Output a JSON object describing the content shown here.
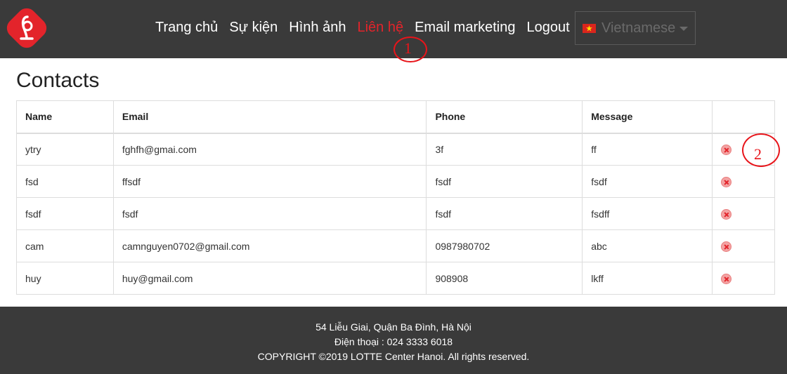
{
  "header": {
    "nav": [
      {
        "label": "Trang chủ",
        "active": false
      },
      {
        "label": "Sự kiện",
        "active": false
      },
      {
        "label": "Hình ảnh",
        "active": false
      },
      {
        "label": "Liên hệ",
        "active": true
      },
      {
        "label": "Email marketing",
        "active": false
      },
      {
        "label": "Logout",
        "active": false
      }
    ],
    "language": {
      "selected": "Vietnamese",
      "flag": "vietnam-flag-icon"
    }
  },
  "annotations": [
    "1",
    "2"
  ],
  "main": {
    "title": "Contacts",
    "table": {
      "columns": [
        "Name",
        "Email",
        "Phone",
        "Message",
        ""
      ],
      "rows": [
        {
          "name": "ytry",
          "email": "fghfh@gmai.com",
          "phone": "3f",
          "message": "ff"
        },
        {
          "name": "fsd",
          "email": "ffsdf",
          "phone": "fsdf",
          "message": "fsdf"
        },
        {
          "name": "fsdf",
          "email": "fsdf",
          "phone": "fsdf",
          "message": "fsdff"
        },
        {
          "name": "cam",
          "email": "camnguyen0702@gmail.com",
          "phone": "0987980702",
          "message": "abc"
        },
        {
          "name": "huy",
          "email": "huy@gmail.com",
          "phone": "908908",
          "message": "lkff"
        }
      ],
      "delete_icon": "delete-circle-x-icon"
    }
  },
  "footer": {
    "address": "54 Liễu Giai, Quận Ba Đình, Hà Nội",
    "phone": "Điện thoại : 024 3333 6018",
    "copyright": "COPYRIGHT ©2019 LOTTE Center Hanoi. All rights reserved."
  },
  "colors": {
    "header_bg": "#3a3a3a",
    "accent": "#e3242b",
    "annotation": "#e8141a"
  }
}
